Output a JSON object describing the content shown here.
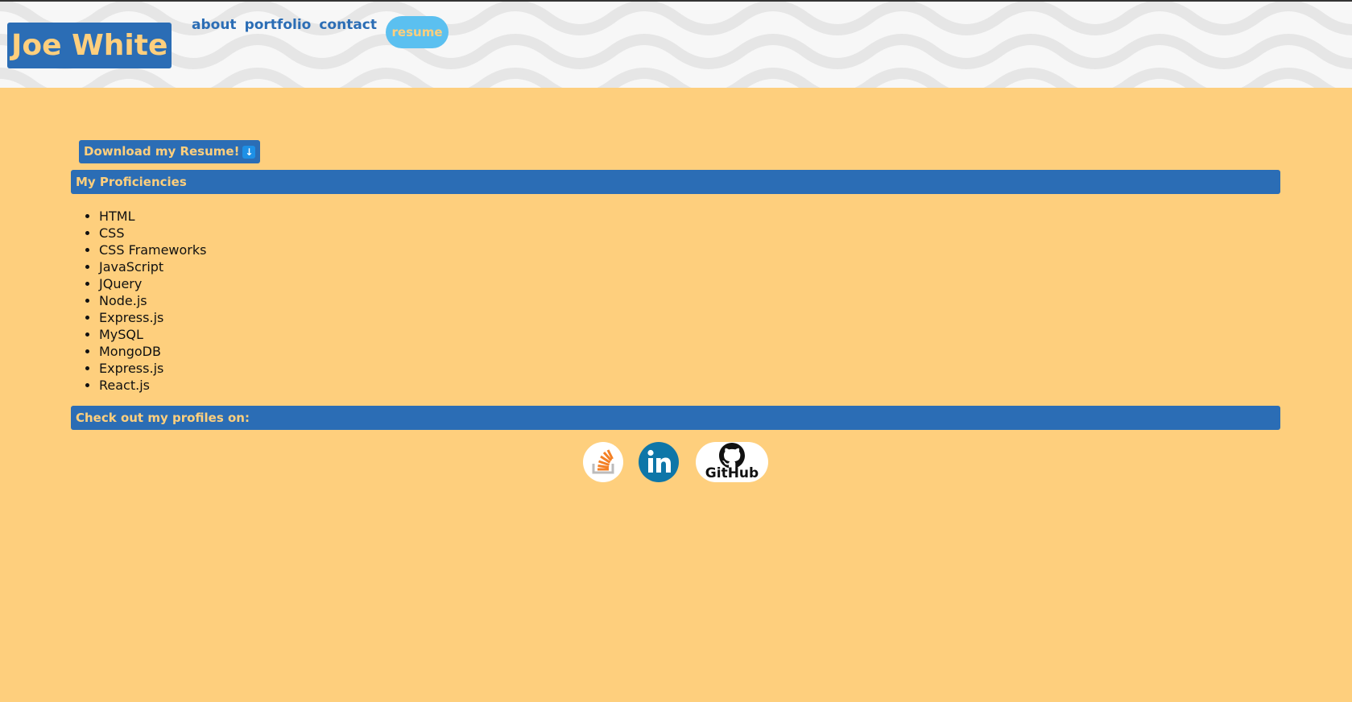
{
  "header": {
    "brand": "Joe White",
    "nav": [
      "about",
      "portfolio",
      "contact"
    ],
    "active_nav": "resume"
  },
  "main": {
    "download_label": "Download my Resume!",
    "download_icon": "download-arrow-icon",
    "proficiencies_title": "My Proficiencies",
    "proficiencies": [
      "HTML",
      "CSS",
      "CSS Frameworks",
      "JavaScript",
      "JQuery",
      "Node.js",
      "Express.js",
      "MySQL",
      "MongoDB",
      "Express.js",
      "React.js"
    ],
    "profiles_title": "Check out my profiles on:",
    "profiles": [
      {
        "name": "stackoverflow-icon"
      },
      {
        "name": "linkedin-icon"
      },
      {
        "name": "github-icon",
        "label": "GitHub"
      }
    ]
  },
  "colors": {
    "page_bg": "#fecf7d",
    "accent": "#2b6db5",
    "pill": "#5bc0f0"
  }
}
